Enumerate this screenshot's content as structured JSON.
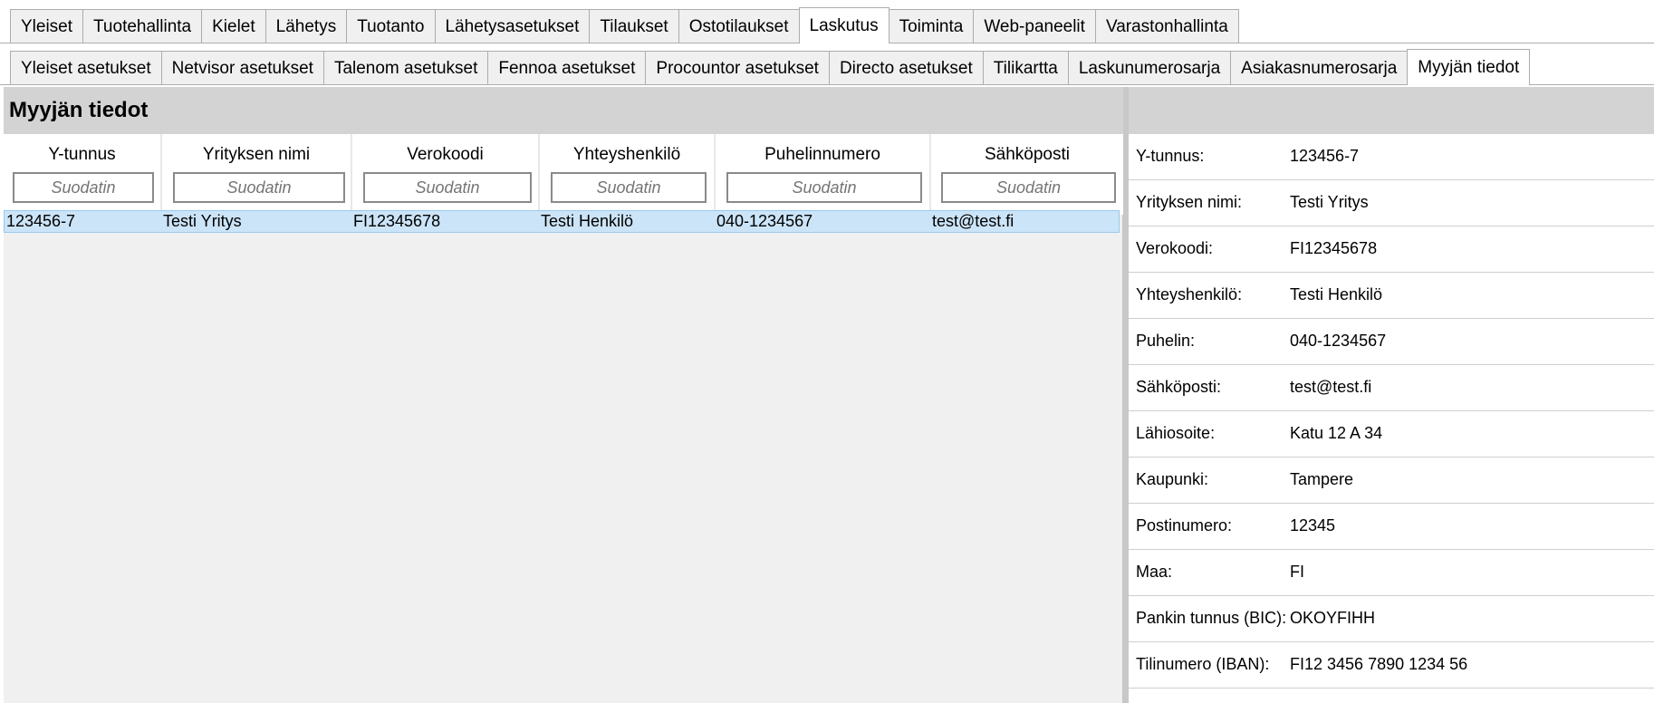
{
  "main_tabs": [
    "Yleiset",
    "Tuotehallinta",
    "Kielet",
    "Lähetys",
    "Tuotanto",
    "Lähetysasetukset",
    "Tilaukset",
    "Ostotilaukset",
    "Laskutus",
    "Toiminta",
    "Web-paneelit",
    "Varastonhallinta"
  ],
  "main_tabs_active": "Laskutus",
  "sub_tabs": [
    "Yleiset asetukset",
    "Netvisor asetukset",
    "Talenom asetukset",
    "Fennoa asetukset",
    "Procountor asetukset",
    "Directo asetukset",
    "Tilikartta",
    "Laskunumerosarja",
    "Asiakasnumerosarja",
    "Myyjän tiedot"
  ],
  "sub_tabs_active": "Myyjän tiedot",
  "left_panel": {
    "title": "Myyjän tiedot",
    "columns": [
      "Y-tunnus",
      "Yrityksen nimi",
      "Verokoodi",
      "Yhteyshenkilö",
      "Puhelinnumero",
      "Sähköposti"
    ],
    "filter_placeholder": "Suodatin",
    "rows": [
      [
        "123456-7",
        "Testi Yritys",
        "FI12345678",
        "Testi Henkilö",
        "040-1234567",
        "test@test.fi"
      ]
    ]
  },
  "details": [
    {
      "label": "Y-tunnus:",
      "value": "123456-7"
    },
    {
      "label": "Yrityksen nimi:",
      "value": "Testi Yritys"
    },
    {
      "label": "Verokoodi:",
      "value": "FI12345678"
    },
    {
      "label": "Yhteyshenkilö:",
      "value": "Testi Henkilö"
    },
    {
      "label": "Puhelin:",
      "value": "040-1234567"
    },
    {
      "label": "Sähköposti:",
      "value": "test@test.fi"
    },
    {
      "label": "Lähiosoite:",
      "value": "Katu 12 A 34"
    },
    {
      "label": "Kaupunki:",
      "value": "Tampere"
    },
    {
      "label": "Postinumero:",
      "value": "12345"
    },
    {
      "label": "Maa:",
      "value": "FI"
    },
    {
      "label": "Pankin tunnus (BIC):",
      "value": "OKOYFIHH"
    },
    {
      "label": "Tilinumero (IBAN):",
      "value": "FI12 3456 7890 1234 56"
    }
  ],
  "colors": {
    "selected_row": "#cce4f7",
    "header_band": "#d3d3d3",
    "pane_bg": "#f0f0f0"
  }
}
